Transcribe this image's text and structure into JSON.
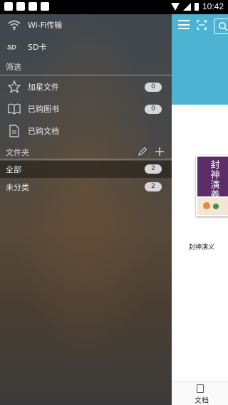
{
  "status_bar": {
    "time": "10:42"
  },
  "drawer": {
    "top_items": [
      {
        "label": "Wi-Fi传输",
        "icon": "wifi-icon"
      },
      {
        "label": "SD卡",
        "icon": "sd-card-icon"
      }
    ],
    "filter_section": {
      "title": "筛选"
    },
    "filter_items": [
      {
        "label": "加星文件",
        "icon": "star-icon",
        "count": "0"
      },
      {
        "label": "已购图书",
        "icon": "book-open-icon",
        "count": "0"
      },
      {
        "label": "已购文档",
        "icon": "document-icon"
      }
    ],
    "folder_section": {
      "title": "文件夹",
      "edit_icon": "pencil-icon",
      "add_icon": "plus-icon"
    },
    "folders": [
      {
        "label": "全部",
        "count": "2",
        "selected": true
      },
      {
        "label": "未分类",
        "count": "2",
        "selected": false
      }
    ]
  },
  "app": {
    "header_color": "#4cb3d3",
    "book": {
      "title": "封神演义",
      "cover_text": "封神演義"
    },
    "bottom_tab": {
      "label": "文档",
      "icon": "document-icon"
    }
  }
}
